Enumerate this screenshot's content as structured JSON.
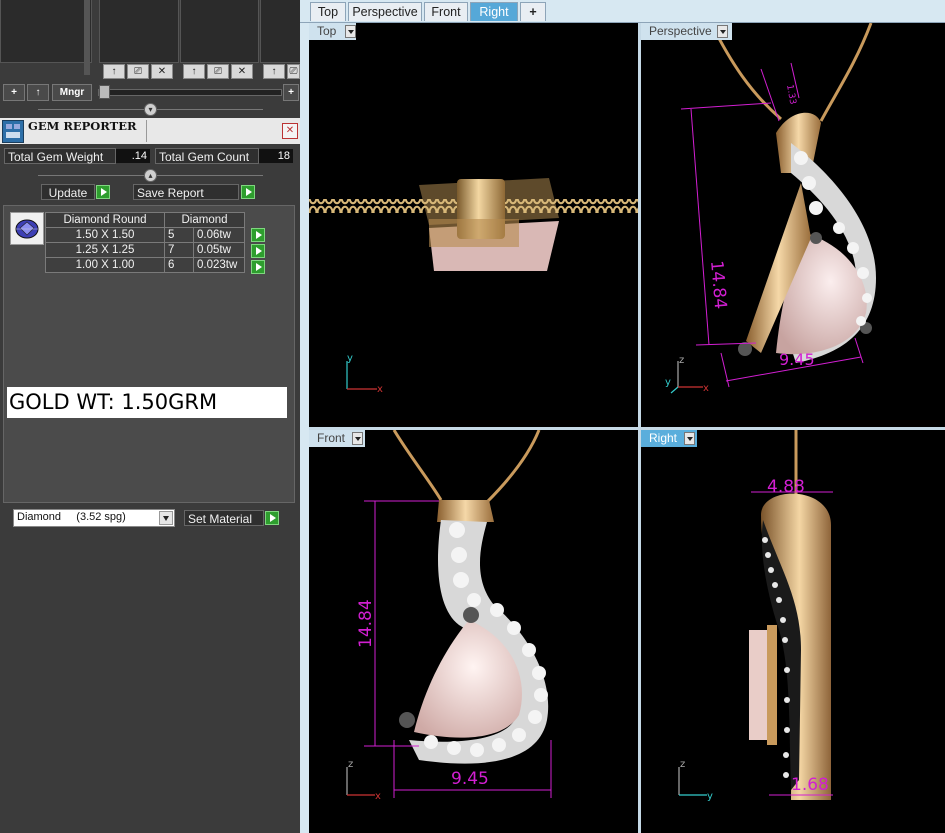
{
  "left_panel": {
    "toolbar": {
      "add": "+",
      "up": "↑",
      "manager": "Mngr",
      "add2": "+"
    },
    "slot_icons": [
      "↑",
      "⎚",
      "✕"
    ],
    "gem_reporter": {
      "title": "GEM REPORTER",
      "close": "✕",
      "total_weight_label": "Total Gem Weight",
      "total_weight_value": ".14",
      "total_count_label": "Total Gem Count",
      "total_count_value": "18",
      "update_label": "Update",
      "save_report_label": "Save Report",
      "table": {
        "headers": [
          "Diamond Round",
          "Diamond"
        ],
        "rows": [
          {
            "size": "1.50 X 1.50",
            "count": "5",
            "weight": "0.06tw"
          },
          {
            "size": "1.25 X 1.25",
            "count": "7",
            "weight": "0.05tw"
          },
          {
            "size": "1.00 X 1.00",
            "count": "6",
            "weight": "0.023tw"
          }
        ]
      },
      "gold_weight": "GOLD WT: 1.50GRM",
      "material_select": "Diamond     (3.52 spg)",
      "set_material_label": "Set Material"
    }
  },
  "tabs": [
    {
      "label": "Top",
      "active": false
    },
    {
      "label": "Perspective",
      "active": false
    },
    {
      "label": "Front",
      "active": false
    },
    {
      "label": "Right",
      "active": true
    },
    {
      "label": "+",
      "active": false
    }
  ],
  "viewports": {
    "top": {
      "label": "Top",
      "axis_a": "y",
      "axis_b": "x"
    },
    "perspective": {
      "label": "Perspective",
      "dim_height": "14.84",
      "dim_width": "9.45",
      "dim_bail": "1.33",
      "axis_a": "z",
      "axis_b": "x",
      "axis_c": "y"
    },
    "front": {
      "label": "Front",
      "dim_height": "14.84",
      "dim_width": "9.45",
      "axis_a": "z",
      "axis_b": "x"
    },
    "right": {
      "label": "Right",
      "dim_top": "4.88",
      "dim_bottom": "1.68",
      "axis_a": "z",
      "axis_b": "y"
    }
  },
  "colors": {
    "dimension": "#d21fd2",
    "gold": "#d9a86a",
    "rose_gem": "#f0d6d0",
    "active_tab": "#56a8d8"
  }
}
